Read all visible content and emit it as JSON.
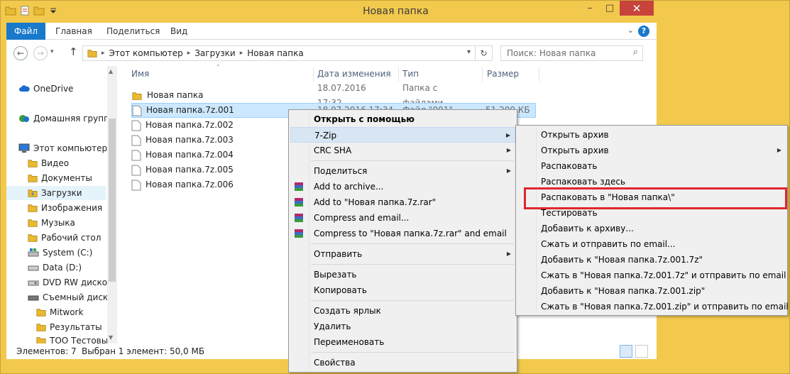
{
  "window": {
    "title": "Новая папка",
    "buttons": [
      "–",
      "□",
      "✕"
    ]
  },
  "ribbon": {
    "tabs": [
      "Файл",
      "Главная",
      "Поделиться",
      "Вид"
    ],
    "help": "?"
  },
  "address": {
    "crumbs": [
      "Этот компьютер",
      "Загрузки",
      "Новая папка"
    ],
    "search_placeholder": "Поиск: Новая папка"
  },
  "nav": {
    "items": [
      {
        "label": "OneDrive",
        "icon": "cloud-icon"
      },
      {
        "label": "Домашняя группа",
        "icon": "homegroup-icon"
      },
      {
        "label": "Этот компьютер",
        "icon": "computer-icon"
      },
      {
        "label": "Видео",
        "icon": "folder-icon"
      },
      {
        "label": "Документы",
        "icon": "folder-icon"
      },
      {
        "label": "Загрузки",
        "icon": "folder-icon",
        "selected": true
      },
      {
        "label": "Изображения",
        "icon": "folder-icon"
      },
      {
        "label": "Музыка",
        "icon": "folder-icon"
      },
      {
        "label": "Рабочий стол",
        "icon": "folder-icon"
      },
      {
        "label": "System (C:)",
        "icon": "drive-icon"
      },
      {
        "label": "Data (D:)",
        "icon": "drive-icon"
      },
      {
        "label": "DVD RW дисково",
        "icon": "dvd-icon"
      },
      {
        "label": "Съемный диск (",
        "icon": "usb-drive-icon"
      },
      {
        "label": "Mitwork",
        "icon": "folder-icon"
      },
      {
        "label": "Результаты",
        "icon": "folder-icon"
      },
      {
        "label": "ТОО Тестовый",
        "icon": "folder-icon"
      }
    ]
  },
  "columns": {
    "name": "Имя",
    "date": "Дата изменения",
    "type": "Тип",
    "size": "Размер"
  },
  "files": [
    {
      "name": "Новая папка",
      "date": "18.07.2016 17:32",
      "type": "Папка с файлами",
      "size": "",
      "icon": "folder-icon"
    },
    {
      "name": "Новая папка.7z.001",
      "date": "18.07.2016 17:34",
      "type": "Файл \"001\"",
      "size": "51 200 КБ",
      "icon": "file-icon",
      "selected": true
    },
    {
      "name": "Новая папка.7z.002",
      "icon": "file-icon"
    },
    {
      "name": "Новая папка.7z.003",
      "icon": "file-icon"
    },
    {
      "name": "Новая папка.7z.004",
      "icon": "file-icon"
    },
    {
      "name": "Новая папка.7z.005",
      "icon": "file-icon"
    },
    {
      "name": "Новая папка.7z.006",
      "icon": "file-icon"
    }
  ],
  "status": {
    "count": "Элементов: 7",
    "selection": "Выбран 1 элемент: 50,0 МБ"
  },
  "context_menu": {
    "open_with": "Открыть с помощью",
    "sevenzip": "7-Zip",
    "crc": "CRC SHA",
    "share": "Поделиться",
    "add_archive": "Add to archive...",
    "add_rar": "Add to \"Новая папка.7z.rar\"",
    "compress_email": "Compress and email...",
    "compress_rar_email": "Compress to \"Новая папка.7z.rar\" and email",
    "send_to": "Отправить",
    "cut": "Вырезать",
    "copy": "Копировать",
    "shortcut": "Создать ярлык",
    "delete": "Удалить",
    "rename": "Переименовать",
    "properties": "Свойства"
  },
  "submenu": {
    "items": [
      "Открыть архив",
      "Открыть архив",
      "Распаковать",
      "Распаковать здесь",
      "Распаковать в \"Новая папка\\\"",
      "Тестировать",
      "Добавить к архиву...",
      "Сжать и отправить по email...",
      "Добавить к \"Новая папка.7z.001.7z\"",
      "Сжать в \"Новая папка.7z.001.7z\" и отправить по email",
      "Добавить к \"Новая папка.7z.001.zip\"",
      "Сжать в \"Новая папка.7z.001.zip\" и отправить по email"
    ]
  },
  "colors": {
    "frame": "#f2c94d",
    "accent": "#1979ca",
    "highlight_box": "#e0262c"
  }
}
